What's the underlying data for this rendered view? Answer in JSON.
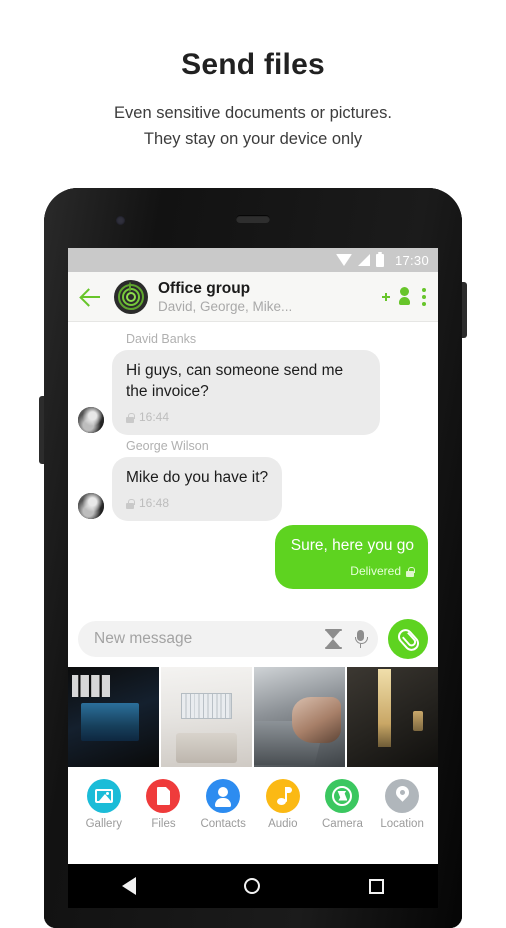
{
  "promo": {
    "title": "Send files",
    "subtitle_line1": "Even sensitive documents or pictures.",
    "subtitle_line2": "They stay on your device only"
  },
  "status_bar": {
    "time": "17:30",
    "icons": [
      "wifi-icon",
      "signal-icon",
      "battery-icon"
    ]
  },
  "app_bar": {
    "back_icon": "back-arrow-icon",
    "avatar_icon": "group-avatar-icon",
    "title": "Office group",
    "subtitle": "David, George, Mike...",
    "add_user_icon": "add-person-icon",
    "overflow_icon": "overflow-menu-icon",
    "accent_color": "#67c52a"
  },
  "conversation": {
    "messages": [
      {
        "sender": "David Banks",
        "text": "Hi guys, can someone send me the invoice?",
        "time": "16:44",
        "lock_icon": "lock-icon",
        "direction": "incoming"
      },
      {
        "sender": "George Wilson",
        "text": "Mike do you have it?",
        "time": "16:48",
        "lock_icon": "lock-icon",
        "direction": "incoming"
      },
      {
        "sender": "",
        "text": "Sure, here you go",
        "status": "Delivered",
        "lock_icon": "lock-icon",
        "direction": "outgoing"
      }
    ]
  },
  "composer": {
    "placeholder": "New message",
    "timer_icon": "hourglass-icon",
    "mic_icon": "microphone-icon",
    "attach_icon": "paperclip-icon",
    "attach_color": "#5ed320"
  },
  "photo_strip": {
    "thumbs": [
      {
        "name": "thumb-work-poster"
      },
      {
        "name": "thumb-office-interior"
      },
      {
        "name": "thumb-laptop-hands"
      },
      {
        "name": "thumb-doorway-light"
      }
    ]
  },
  "attachment_options": [
    {
      "label": "Gallery",
      "icon": "gallery-icon",
      "color": "#1bbcd8"
    },
    {
      "label": "Files",
      "icon": "file-icon",
      "color": "#ef3b3b"
    },
    {
      "label": "Contacts",
      "icon": "contact-icon",
      "color": "#2d8cf0"
    },
    {
      "label": "Audio",
      "icon": "music-note-icon",
      "color": "#fbb914"
    },
    {
      "label": "Camera",
      "icon": "camera-icon",
      "color": "#3bc760"
    },
    {
      "label": "Location",
      "icon": "location-pin-icon",
      "color": "#b0b6bb"
    }
  ],
  "nav_bar": {
    "back_icon": "nav-back-icon",
    "home_icon": "nav-home-icon",
    "recents_icon": "nav-recents-icon"
  }
}
